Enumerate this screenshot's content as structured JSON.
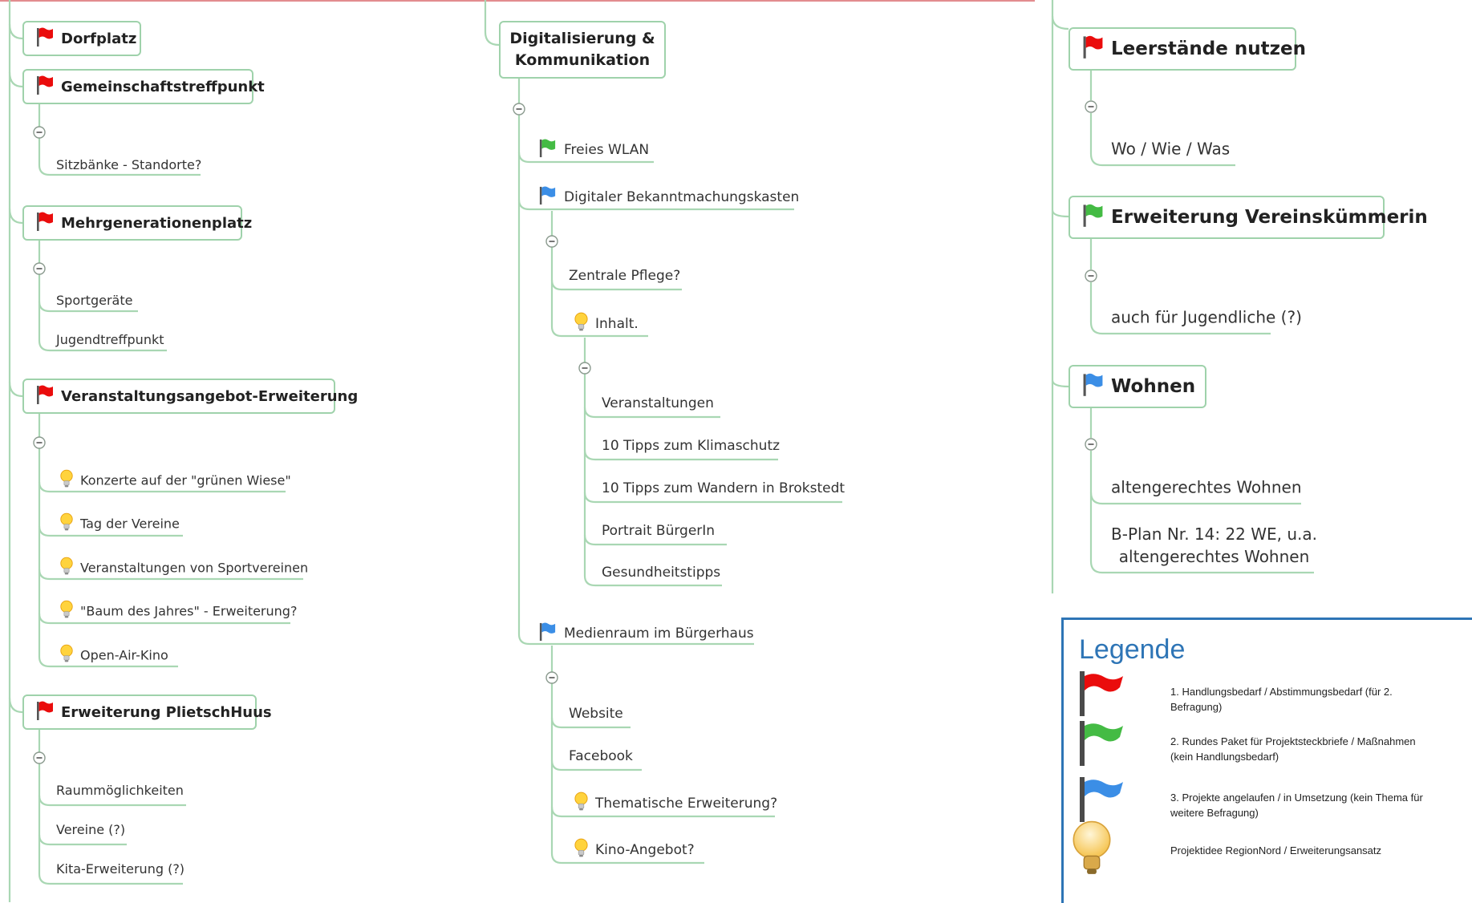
{
  "colors": {
    "branch": "#a9d7b3",
    "topic_border": "#9fd2ab",
    "flag_red": "#ea0c0c",
    "flag_green": "#44bb44",
    "flag_blue": "#3b8ee6",
    "legend_blue": "#2e75b6",
    "header_line": "#d9666a"
  },
  "left": {
    "dorfplatz": {
      "label": "Dorfplatz",
      "flag": "red"
    },
    "gemeinschaft": {
      "label": "Gemeinschaftstreffpunkt",
      "flag": "red",
      "children": [
        {
          "label": "Sitzbänke - Standorte?"
        }
      ]
    },
    "mehrgenerationen": {
      "label": "Mehrgenerationenplatz",
      "flag": "red",
      "children": [
        {
          "label": "Sportgeräte"
        },
        {
          "label": "Jugendtreffpunkt"
        }
      ]
    },
    "veranstaltung": {
      "label": "Veranstaltungsangebot-Erweiterung",
      "flag": "red",
      "children": [
        {
          "label": "Konzerte auf der \"grünen Wiese\"",
          "icon": "lightbulb-icon"
        },
        {
          "label": "Tag der Vereine",
          "icon": "lightbulb-icon"
        },
        {
          "label": "Veranstaltungen von Sportvereinen",
          "icon": "lightbulb-icon"
        },
        {
          "label": "\"Baum des Jahres\" - Erweiterung?",
          "icon": "lightbulb-icon"
        },
        {
          "label": "Open-Air-Kino",
          "icon": "lightbulb-icon"
        }
      ]
    },
    "plietsch": {
      "label": "Erweiterung PlietschHuus",
      "flag": "red",
      "children": [
        {
          "label": "Raummöglichkeiten"
        },
        {
          "label": "Vereine (?)"
        },
        {
          "label": "Kita-Erweiterung (?)"
        }
      ]
    }
  },
  "middle": {
    "title_line1": "Digitalisierung &",
    "title_line2": "Kommunikation",
    "wlan": {
      "label": "Freies WLAN",
      "flag": "green"
    },
    "kasten": {
      "label": "Digitaler Bekanntmachungskasten",
      "flag": "blue",
      "children": {
        "pflege": "Zentrale Pflege?",
        "inhalt": "Inhalt."
      }
    },
    "inhalt_items": [
      "Veranstaltungen",
      "10 Tipps zum Klimaschutz",
      "10 Tipps zum Wandern in Brokstedt",
      "Portrait BürgerIn",
      "Gesundheitstipps"
    ],
    "medienraum": {
      "label": "Medienraum im Bürgerhaus",
      "flag": "blue",
      "children": [
        {
          "label": "Website"
        },
        {
          "label": "Facebook"
        },
        {
          "label": "Thematische Erweiterung?",
          "icon": "lightbulb-icon"
        },
        {
          "label": "Kino-Angebot?",
          "icon": "lightbulb-icon"
        }
      ]
    }
  },
  "right": {
    "leerstaende": {
      "label": "Leerstände nutzen",
      "flag": "red",
      "children": [
        "Wo / Wie / Was"
      ]
    },
    "verein": {
      "label": "Erweiterung Vereinskümmerin",
      "flag": "green",
      "children": [
        "auch für Jugendliche (?)"
      ]
    },
    "wohnen": {
      "label": "Wohnen",
      "flag": "blue",
      "children": [
        "altengerechtes Wohnen",
        "B-Plan Nr. 14: 22 WE, u.a.",
        "altengerechtes Wohnen"
      ]
    }
  },
  "legend": {
    "title": "Legende",
    "items": [
      {
        "icon": "red-flag-icon",
        "line1": "1. Handlungsbedarf / Abstimmungsbedarf (für 2.",
        "line2": "Befragung)"
      },
      {
        "icon": "green-flag-icon",
        "line1": "2. Rundes Paket für Projektsteckbriefe / Maßnahmen",
        "line2": "(kein Handlungsbedarf)"
      },
      {
        "icon": "blue-flag-icon",
        "line1": "3. Projekte angelaufen / in Umsetzung (kein Thema für",
        "line2": "weitere Befragung)"
      },
      {
        "icon": "lightbulb-icon",
        "line1": "Projektidee RegionNord / Erweiterungsansatz",
        "line2": ""
      }
    ]
  }
}
